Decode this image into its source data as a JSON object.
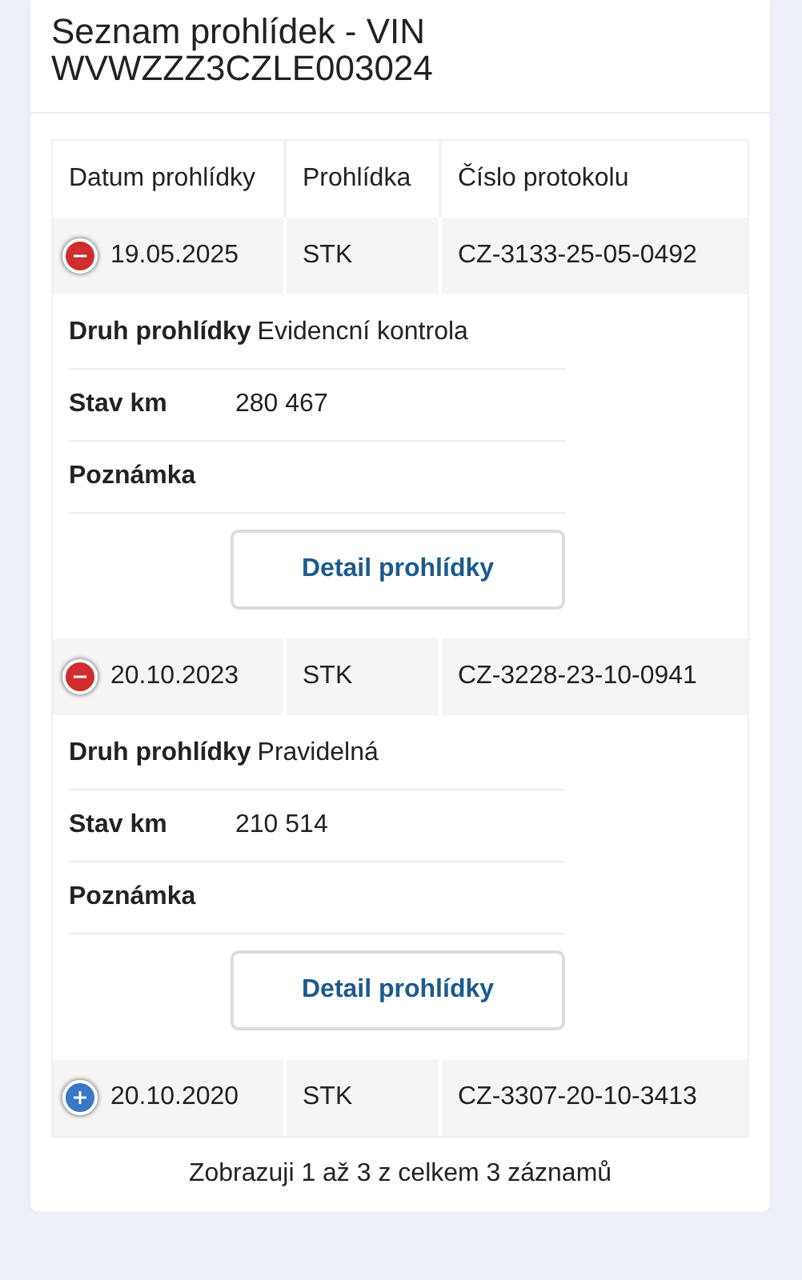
{
  "title": "Seznam prohlídek - VIN WVWZZZ3CZLE003024",
  "columns": [
    "Datum prohlídky",
    "Prohlídka",
    "Číslo protokolu"
  ],
  "rows": [
    {
      "date": "19.05.2025",
      "type": "STK",
      "protocol": "CZ-3133-25-05-0492",
      "expanded": true,
      "details": [
        {
          "label": "Druh prohlídky",
          "value": "Evidencní kontrola"
        },
        {
          "label": "Stav km",
          "value": "280 467"
        },
        {
          "label": "Poznámka"
        }
      ],
      "button": "Detail prohlídky"
    },
    {
      "date": "20.10.2023",
      "type": "STK",
      "protocol": "CZ-3228-23-10-0941",
      "expanded": true,
      "details": [
        {
          "label": "Druh prohlídky",
          "value": "Pravidelná"
        },
        {
          "label": "Stav km",
          "value": "210 514"
        },
        {
          "label": "Poznámka"
        }
      ],
      "button": "Detail prohlídky"
    },
    {
      "date": "20.10.2020",
      "type": "STK",
      "protocol": "CZ-3307-20-10-3413",
      "expanded": false
    }
  ],
  "info": "Zobrazuji 1 až 3 z celkem 3 záznamů"
}
